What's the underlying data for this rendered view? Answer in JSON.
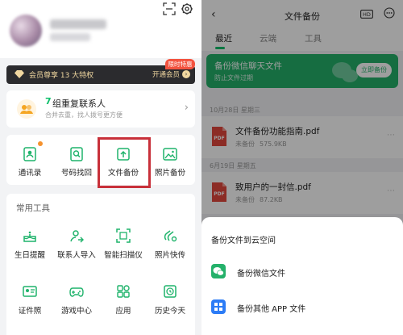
{
  "left": {
    "vip": {
      "text": "会员尊享 13 大特权",
      "action": "开通会员",
      "badge": "限时特惠"
    },
    "merge": {
      "number": "7",
      "title": "组重复联系人",
      "subtitle": "合并去重，找人拨号更方便"
    },
    "functions": [
      {
        "label": "通讯录",
        "icon": "contacts-icon"
      },
      {
        "label": "号码找回",
        "icon": "number-recovery-icon"
      },
      {
        "label": "文件备份",
        "icon": "file-backup-icon"
      },
      {
        "label": "照片备份",
        "icon": "photo-backup-icon"
      }
    ],
    "tools_title": "常用工具",
    "tools": [
      {
        "label": "生日提醒",
        "icon": "birthday-cake-icon"
      },
      {
        "label": "联系人导入",
        "icon": "contact-import-icon"
      },
      {
        "label": "智能扫描仪",
        "icon": "scanner-icon"
      },
      {
        "label": "照片快传",
        "icon": "photo-transfer-icon"
      },
      {
        "label": "证件照",
        "icon": "id-photo-icon"
      },
      {
        "label": "游戏中心",
        "icon": "gamepad-icon"
      },
      {
        "label": "应用",
        "icon": "apps-icon"
      },
      {
        "label": "历史今天",
        "icon": "history-clock-icon"
      }
    ]
  },
  "right": {
    "title": "文件备份",
    "tabs": [
      "最近",
      "云端",
      "工具"
    ],
    "wechat": {
      "title": "备份微信聊天文件",
      "subtitle": "防止文件过期",
      "button": "立即备份"
    },
    "groups": [
      {
        "date": "10月28日 星期三",
        "file": {
          "name": "文件备份功能指南.pdf",
          "status": "未备份",
          "size": "575.9KB"
        }
      },
      {
        "date": "6月19日 星期五",
        "file": {
          "name": "致用户的一封信.pdf",
          "status": "未备份",
          "size": "87.2KB"
        }
      }
    ],
    "sheet": {
      "title": "备份文件到云空间",
      "items": [
        {
          "label": "备份微信文件",
          "icon": "wechat-icon"
        },
        {
          "label": "备份其他 APP 文件",
          "icon": "apps-grid-icon"
        }
      ]
    }
  },
  "colors": {
    "accent_green": "#0bbf6a",
    "wechat_green": "#24b16a",
    "highlight_red": "#c8303a",
    "vip_gold": "#f0d7a0"
  }
}
